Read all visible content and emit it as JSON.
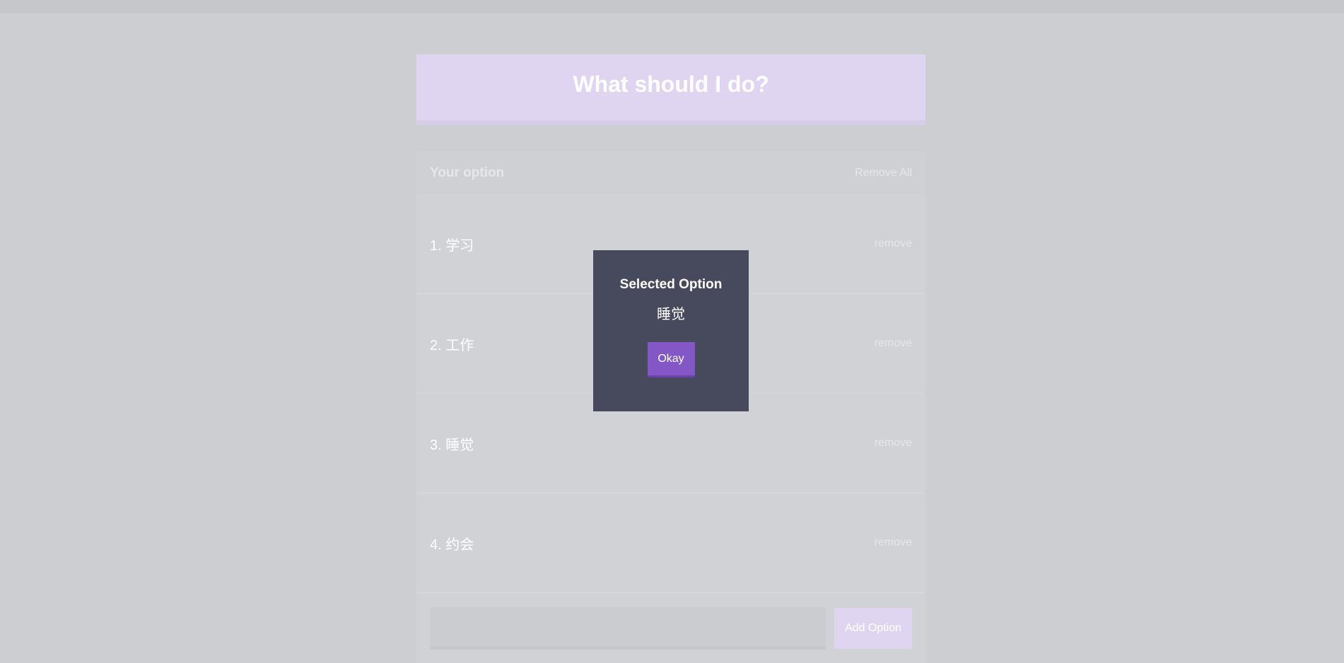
{
  "app": {
    "title": "What should I do?"
  },
  "options_panel": {
    "title": "Your option",
    "remove_all_label": "Remove All",
    "remove_label": "remove",
    "items": [
      {
        "label": "1. 学习"
      },
      {
        "label": "2. 工作"
      },
      {
        "label": "3. 睡觉"
      },
      {
        "label": "4. 约会"
      }
    ]
  },
  "add_form": {
    "input_value": "",
    "button_label": "Add Option"
  },
  "modal": {
    "title": "Selected Option",
    "value": "睡觉",
    "button_label": "Okay"
  },
  "colors": {
    "header_bg": "#dfd5f0",
    "modal_bg": "#474a5d",
    "accent": "#8357c5",
    "overlay_bg": "#ccced2"
  }
}
